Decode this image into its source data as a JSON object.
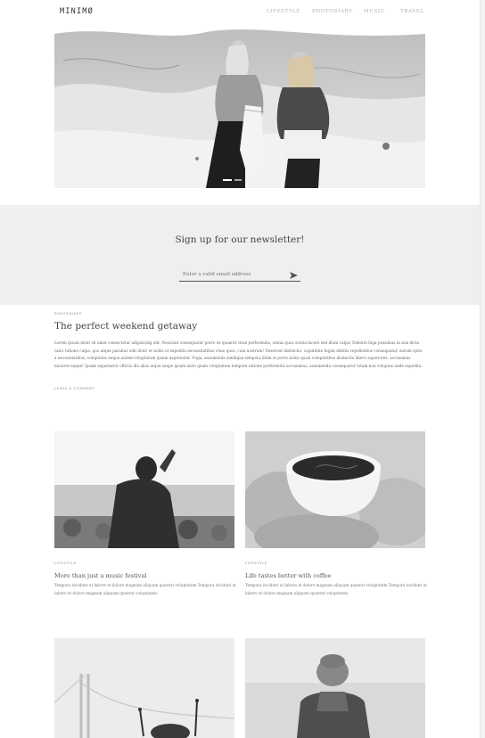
{
  "header": {
    "logo": "MINIMØ",
    "nav": [
      "LIFESTYLE",
      "PHOTODIARY",
      "MUSIC",
      "TRAVEL"
    ]
  },
  "hero": {
    "slides": 2,
    "active_slide": 1
  },
  "newsletter": {
    "title": "Sign up for our newsletter!",
    "placeholder": "Enter a valid email address",
    "send_icon": "send-icon"
  },
  "featured": {
    "category": "PHOTODIARY",
    "title": "The perfect weekend getaway",
    "body": "Lorem ipsum dolor sit amet consectetur adipisicing elit. Nesciunt consequatur porro ex quaerat vitae perferendis, omnis quos soluta facere sed illum culpa! Deleniti fuga possimus in non dicta iusto ratione culpa, quo atque pariatur odit dolor et nobis ut expedita necessitatibus vitae quos, cum nostrum! Deserunt distinctio, cupiditate fugiat debitis repellendus consequatur, earum optio a necessitatibus, voluptates neque autem voluptatum ipsum aspernatur. Fuga, assumenda similique tempora illum in porro nobis quasi voluptatibus distinctio libero asperiores, accusamus maiores eaque! Ipsam aspernatur officiis illo alias atque saepe ipsam iusto quam voluptatem tempore ratione perferendis accusamus, assumenda consequatur totam non voluptas unde expedita.",
    "leave_comment": "LEAVE A COMMENT"
  },
  "posts": [
    {
      "category": "LIFESTYLE",
      "title": "More than just a music festival",
      "body": "Tempora incidunt ut labore et dolore magnam aliquam quaerat voluptatem.Tempora incidunt ut labore et dolore magnam aliquam quaerat voluptatem."
    },
    {
      "category": "LIFESTYLE",
      "title": "Life tastes better with coffee",
      "body": "Tempora incidunt ut labore et dolore magnam aliquam quaerat voluptatem.Tempora incidunt ut labore et dolore magnam aliquam quaerat voluptatem."
    }
  ]
}
